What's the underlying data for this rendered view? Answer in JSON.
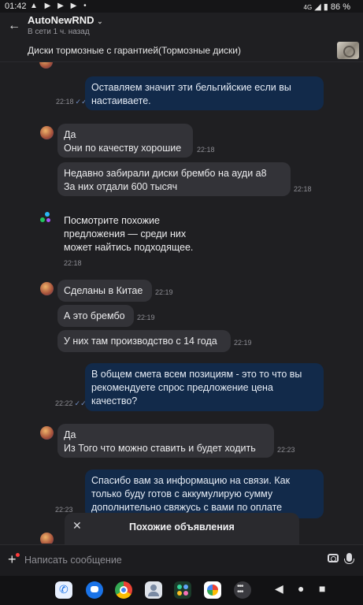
{
  "status_bar": {
    "time": "01:42",
    "battery": "86 %",
    "network": "4G",
    "icons": [
      "alert-icon",
      "youtube-icon",
      "youtube-icon",
      "youtube-icon",
      "dot-icon"
    ]
  },
  "header": {
    "title": "AutoNewRND",
    "subtitle": "В сети 1 ч. назад"
  },
  "product": {
    "title": "Диски тормозные с гарантией(Тормозные диски)"
  },
  "messages": [
    {
      "dir": "out",
      "lines": [
        "Оставляем значит эти бельгийские если вы",
        "настаиваете."
      ],
      "time": "22:18"
    },
    {
      "dir": "in",
      "lines": [
        "Да",
        "Они по качеству хорошие"
      ],
      "time": "22:18"
    },
    {
      "dir": "in",
      "lines": [
        "Недавно забирали диски брембо на ауди а8",
        "За них отдали 600 тысяч"
      ],
      "time": "22:18"
    },
    {
      "dir": "system",
      "lines": [
        "Посмотрите похожие",
        "предложения — среди них",
        "может найтись подходящее."
      ],
      "time": "22:18"
    },
    {
      "dir": "in",
      "lines": [
        "Сделаны в Китае"
      ],
      "time": "22:19"
    },
    {
      "dir": "in",
      "lines": [
        "А это брембо"
      ],
      "time": "22:19"
    },
    {
      "dir": "in",
      "lines": [
        "У них там производство с 14 года"
      ],
      "time": "22:19"
    },
    {
      "dir": "out",
      "lines": [
        "В общем смета всем позициям - это то что вы",
        "рекомендуете спрос предложение цена",
        "качество?"
      ],
      "time": "22:22"
    },
    {
      "dir": "in",
      "lines": [
        "Да",
        "Из Того что можно ставить и будет ходить"
      ],
      "time": "22:23"
    },
    {
      "dir": "out",
      "lines": [
        "Спасибо вам за информацию на связи. Как",
        "только буду готов с аккумулирую сумму",
        "дополнительно свяжусь с вами по оплате"
      ],
      "time": "22:23"
    }
  ],
  "sheet": {
    "title": "Похожие объявления"
  },
  "composer": {
    "placeholder": "Написать сообщение"
  },
  "colors": {
    "out_bubble": "#122a4a",
    "in_bubble": "#333338",
    "background": "#1f1f22"
  }
}
